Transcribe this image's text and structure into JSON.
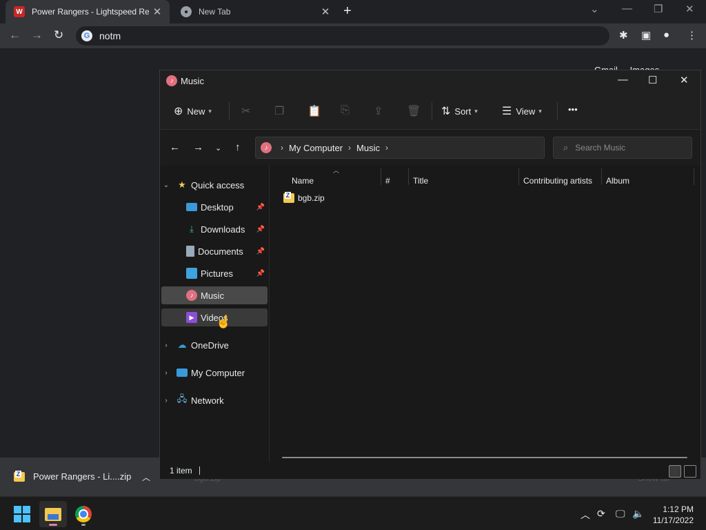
{
  "browser": {
    "tabs": [
      {
        "title": "Power Rangers - Lightspeed Resc",
        "favicon": "W"
      },
      {
        "title": "New Tab",
        "favicon": "chrome"
      }
    ],
    "new_tab_symbol": "+",
    "address": "notm",
    "ntp_links": [
      "Gmail",
      "Images"
    ]
  },
  "explorer": {
    "title": "Music",
    "toolbar": {
      "new_label": "New",
      "sort_label": "Sort",
      "view_label": "View",
      "more_label": "•••"
    },
    "breadcrumb": [
      "My Computer",
      "Music"
    ],
    "search_placeholder": "Search Music",
    "nav": {
      "quick_access": "Quick access",
      "items": [
        {
          "label": "Desktop",
          "pinned": true
        },
        {
          "label": "Downloads",
          "pinned": true
        },
        {
          "label": "Documents",
          "pinned": true
        },
        {
          "label": "Pictures",
          "pinned": true
        },
        {
          "label": "Music",
          "pinned": false,
          "selected": true
        },
        {
          "label": "Videos",
          "pinned": false,
          "hovered": true
        }
      ],
      "onedrive": "OneDrive",
      "my_computer": "My Computer",
      "network": "Network"
    },
    "columns": [
      "Name",
      "#",
      "Title",
      "Contributing artists",
      "Album"
    ],
    "files": [
      {
        "name": "bgb.zip",
        "icon": "zip-folder-icon"
      }
    ],
    "status": "1 item"
  },
  "download_bar": {
    "item": "Power Rangers - Li....zip",
    "ghost_item": "bgb.zip",
    "show_all": "Show all"
  },
  "taskbar": {
    "time": "1:12 PM",
    "date": "11/17/2022"
  },
  "colors": {
    "accent": "#4cc2ff",
    "selected_nav": "#494949",
    "music_icon": "#e2707e",
    "zip_folder": "#f3c94f"
  }
}
